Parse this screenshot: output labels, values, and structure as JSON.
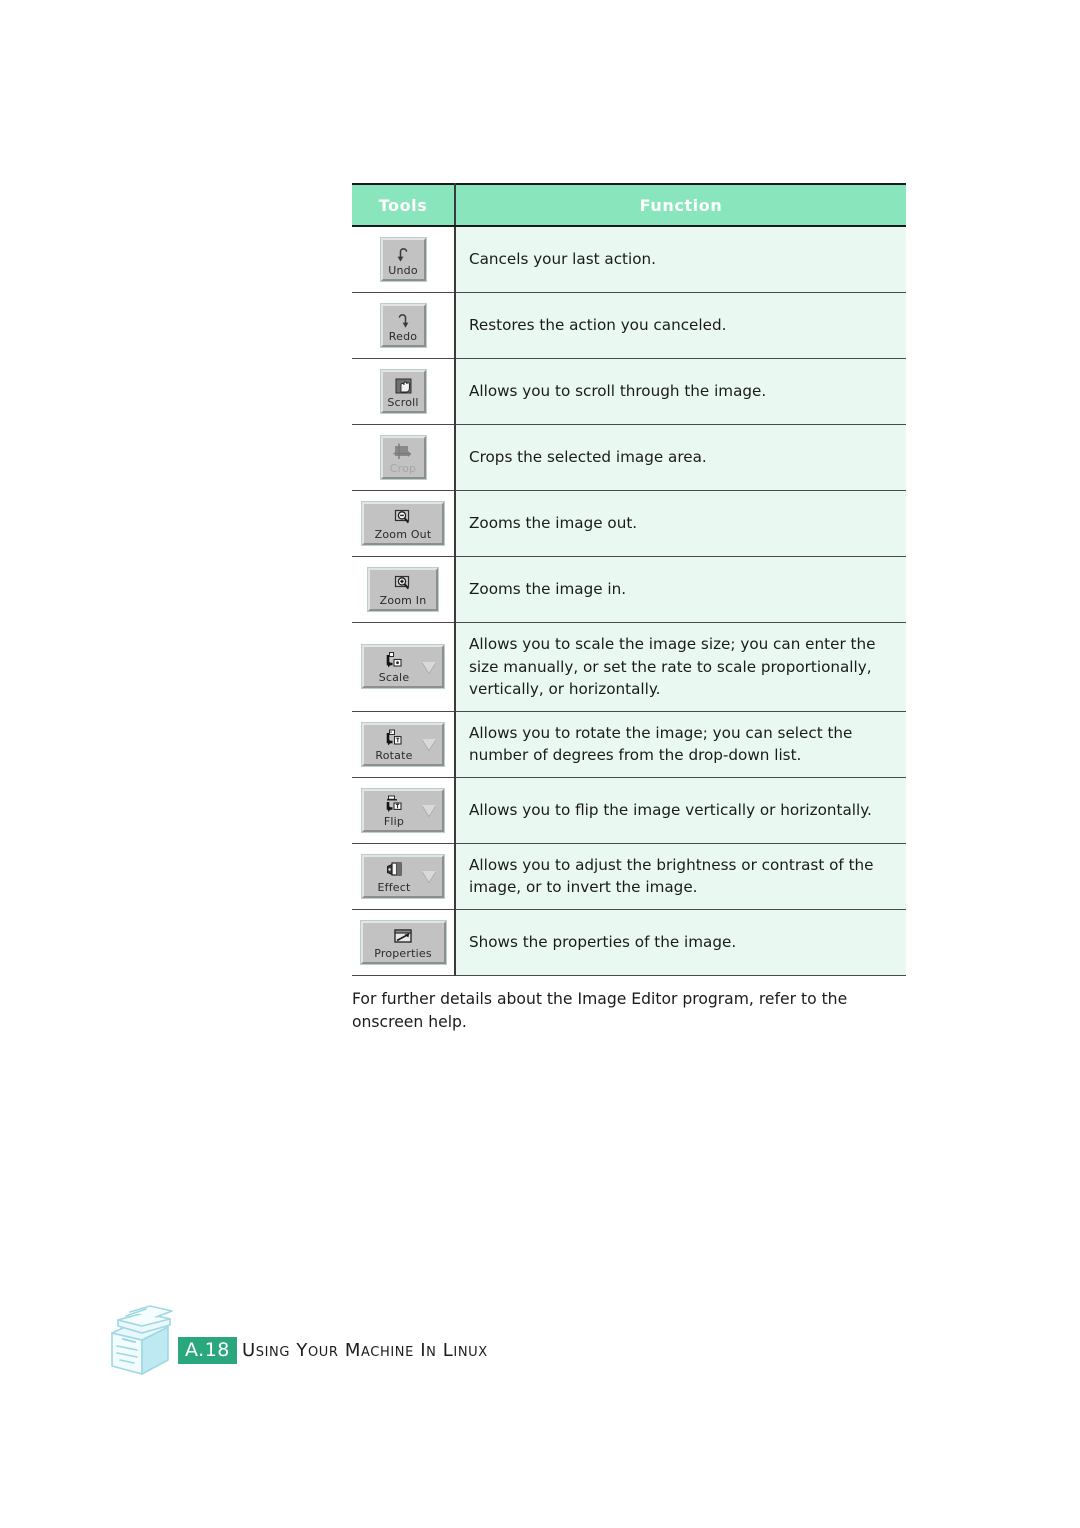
{
  "table": {
    "headers": [
      "Tools",
      "Function"
    ],
    "header_bg": "#88E5BC",
    "header_text_color": "#FFFFFF",
    "function_cell_bg": "#E9F9F2",
    "tools_cell_bg": "#FFFFFF",
    "rows": [
      {
        "tool": "Undo",
        "icon": "undo-arrow-icon",
        "disabled": false,
        "caret": false,
        "function": "Cancels your last action."
      },
      {
        "tool": "Redo",
        "icon": "redo-arrow-icon",
        "disabled": false,
        "caret": false,
        "function": "Restores the action you canceled."
      },
      {
        "tool": "Scroll",
        "icon": "hand-scroll-icon",
        "disabled": false,
        "caret": false,
        "function": "Allows you to scroll through the image."
      },
      {
        "tool": "Crop",
        "icon": "crop-icon",
        "disabled": true,
        "caret": false,
        "function": "Crops the selected image area."
      },
      {
        "tool": "Zoom Out",
        "icon": "magnifier-minus-icon",
        "disabled": false,
        "caret": false,
        "function": "Zooms the image out."
      },
      {
        "tool": "Zoom In",
        "icon": "magnifier-plus-icon",
        "disabled": false,
        "caret": false,
        "function": "Zooms the image in."
      },
      {
        "tool": "Scale",
        "icon": "scale-image-icon",
        "disabled": false,
        "caret": true,
        "function": "Allows you to scale the image size; you can enter the size manually, or set the rate to scale proportionally, vertically, or horizontally."
      },
      {
        "tool": "Rotate",
        "icon": "rotate-image-icon",
        "disabled": false,
        "caret": true,
        "function": "Allows you to rotate the image; you can select the number of degrees from the drop-down list."
      },
      {
        "tool": "Flip",
        "icon": "flip-image-icon",
        "disabled": false,
        "caret": true,
        "function": "Allows you to flip the image vertically or horizontally."
      },
      {
        "tool": "Effect",
        "icon": "effect-image-icon",
        "disabled": false,
        "caret": true,
        "function": "Allows you to adjust the brightness or contrast of the image, or to invert the image."
      },
      {
        "tool": "Properties",
        "icon": "image-properties-icon",
        "disabled": false,
        "caret": false,
        "function": "Shows the properties of the image."
      }
    ]
  },
  "note": "For further details about the Image Editor program, refer to the onscreen help.",
  "footer": {
    "page_number": "A.18",
    "title": "Using Your Machine In Linux",
    "badge_color": "#2AA77C",
    "printer_icon": "multifunction-printer-illustration"
  }
}
